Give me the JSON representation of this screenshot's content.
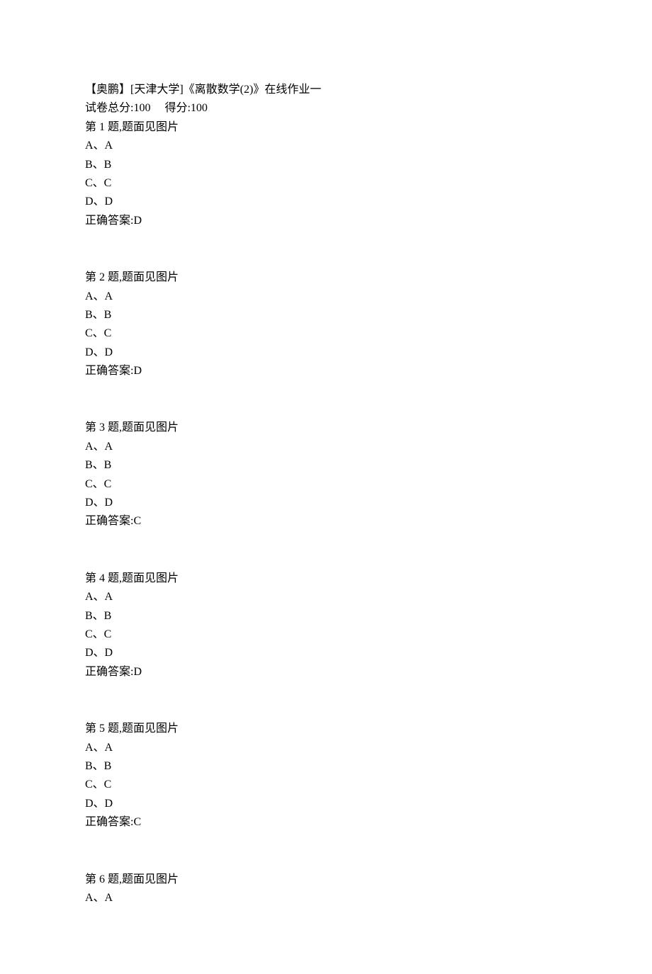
{
  "header": {
    "title": "【奥鹏】[天津大学]《离散数学(2)》在线作业一",
    "score_label": "试卷总分:",
    "score_value": "100",
    "spacer": "     ",
    "result_label": "得分:",
    "result_value": "100"
  },
  "option_labels": {
    "a": "A、A",
    "b": "B、B",
    "c": "C、C",
    "d": "D、D"
  },
  "answer_prefix": "正确答案:",
  "questions": [
    {
      "title": "第 1 题,题面见图片",
      "answer": "D",
      "show_options": true,
      "show_answer": true
    },
    {
      "title": "第 2 题,题面见图片",
      "answer": "D",
      "show_options": true,
      "show_answer": true
    },
    {
      "title": "第 3 题,题面见图片",
      "answer": "C",
      "show_options": true,
      "show_answer": true
    },
    {
      "title": "第 4 题,题面见图片",
      "answer": "D",
      "show_options": true,
      "show_answer": true
    },
    {
      "title": "第 5 题,题面见图片",
      "answer": "C",
      "show_options": true,
      "show_answer": true
    },
    {
      "title": "第 6 题,题面见图片",
      "answer": "",
      "show_options": false,
      "show_answer": false,
      "partial_options": [
        "a"
      ]
    }
  ]
}
